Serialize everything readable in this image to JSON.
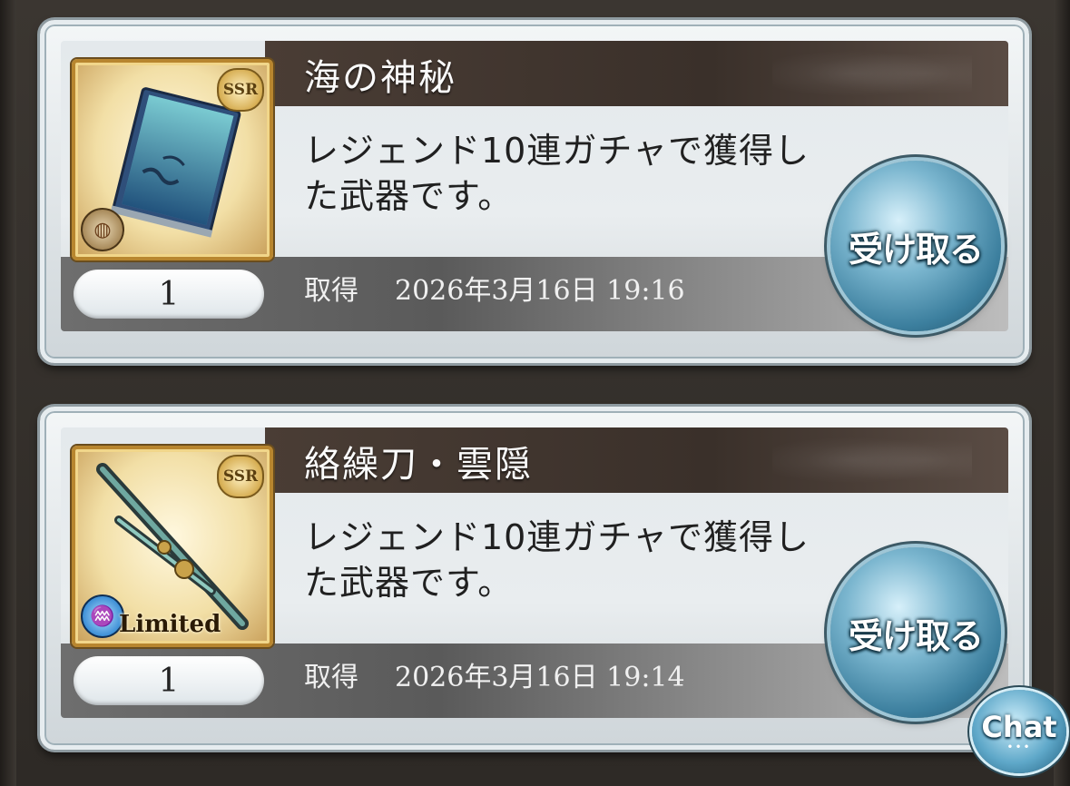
{
  "items": [
    {
      "title": "海の神秘",
      "description": "レジェンド10連ガチャで獲得した武器です。",
      "rarity": "SSR",
      "badge_text": "",
      "quantity": "1",
      "obtained_label": "取得",
      "obtained_date": "2026年3月16日 19:16",
      "claim_label": "受け取る",
      "thumbnail": "book-icon",
      "element": "earth-element-icon"
    },
    {
      "title": "絡繰刀・雲隠",
      "description": "レジェンド10連ガチャで獲得した武器です。",
      "rarity": "SSR",
      "badge_text": "Limited",
      "quantity": "1",
      "obtained_label": "取得",
      "obtained_date": "2026年3月16日 19:14",
      "claim_label": "受け取る",
      "thumbnail": "katana-icon",
      "element": "water-element-icon"
    }
  ],
  "chat": {
    "label": "Chat",
    "dots": "•••"
  },
  "colors": {
    "card_border": "#e6ecef",
    "title_bar": "#3a302a",
    "claim_button": "#3c7f9e"
  }
}
